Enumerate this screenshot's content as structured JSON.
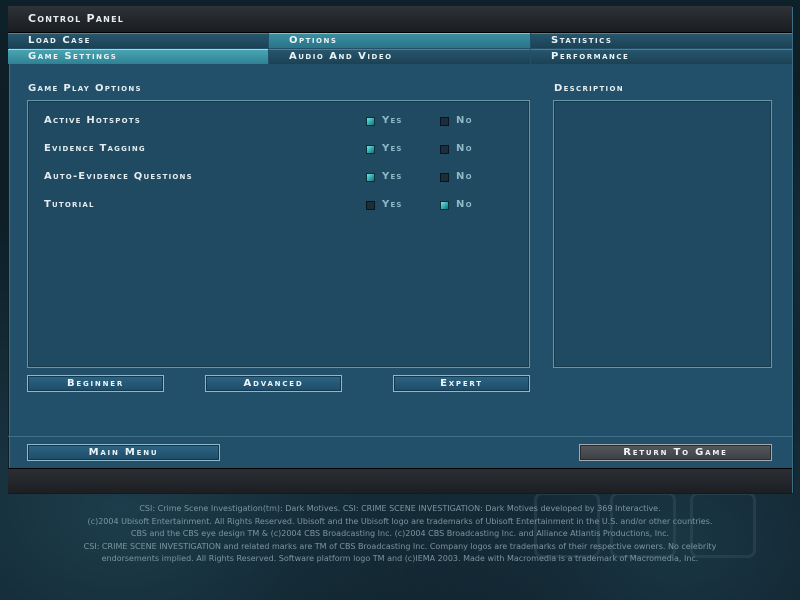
{
  "window": {
    "title": "Control Panel"
  },
  "tabs": {
    "row1": [
      {
        "label": "Load Case"
      },
      {
        "label": "Options"
      },
      {
        "label": "Statistics"
      }
    ],
    "row2": [
      {
        "label": "Game Settings"
      },
      {
        "label": "Audio And Video"
      },
      {
        "label": "Performance"
      }
    ]
  },
  "game_play": {
    "heading": "Game Play Options",
    "options": [
      {
        "label": "Active Hotspots",
        "yes": "Yes",
        "no": "No",
        "value": "yes"
      },
      {
        "label": "Evidence Tagging",
        "yes": "Yes",
        "no": "No",
        "value": "yes"
      },
      {
        "label": "Auto-Evidence Questions",
        "yes": "Yes",
        "no": "No",
        "value": "yes"
      },
      {
        "label": "Tutorial",
        "yes": "Yes",
        "no": "No",
        "value": "no"
      }
    ]
  },
  "description": {
    "heading": "Description",
    "text": ""
  },
  "presets": {
    "beginner": "Beginner",
    "advanced": "Advanced",
    "expert": "Expert"
  },
  "footer": {
    "main_menu": "Main Menu",
    "return_to_game": "Return To Game"
  },
  "legal": [
    "CSI: Crime Scene Investigation(tm): Dark Motives.  CSI: CRIME SCENE INVESTIGATION: Dark Motives developed by 369 Interactive.",
    "(c)2004 Ubisoft Entertainment. All Rights Reserved. Ubisoft and the Ubisoft logo are trademarks of Ubisoft Entertainment in the U.S. and/or other countries.",
    "CBS and the CBS eye design TM & (c)2004 CBS Broadcasting Inc. (c)2004 CBS Broadcasting Inc. and Alliance Atlantis Productions, Inc.",
    "CSI: CRIME SCENE INVESTIGATION and related marks are TM of CBS Broadcasting Inc. Company logos are trademarks of their respective owners. No celebrity",
    "endorsements implied. All Rights Reserved. Software platform logo TM and (c)IEMA 2003. Made with Macromedia is a trademark of Macromedia, Inc."
  ],
  "colors": {
    "panel_bg": "#22506a",
    "checkbox_on": "#2aa3a8",
    "option_text": "#8fb9c6"
  }
}
